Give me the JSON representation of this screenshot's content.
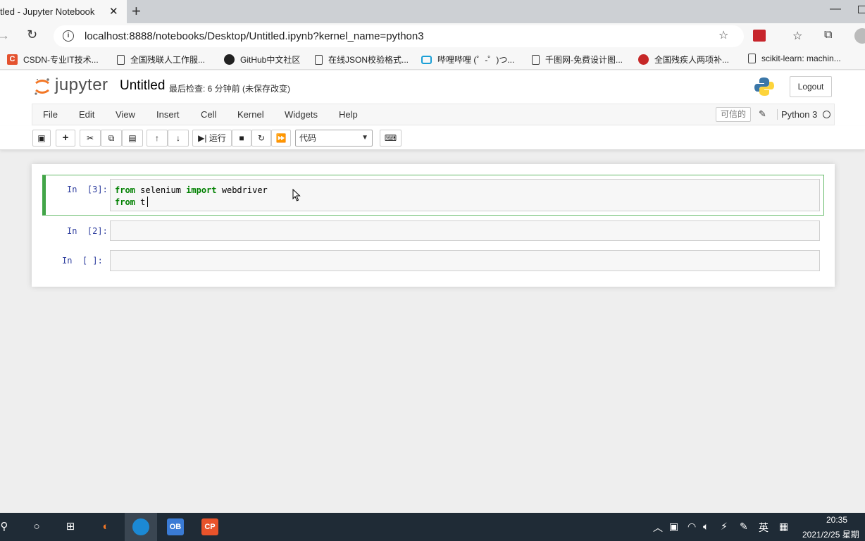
{
  "browser": {
    "tab_title": "tled - Jupyter Notebook",
    "tab_close": "✕",
    "new_tab": "+",
    "url": "localhost:8888/notebooks/Desktop/Untitled.ipynb?kernel_name=python3",
    "bookmarks": [
      {
        "label": "CSDN-专业IT技术...",
        "icon": "csdn-icon"
      },
      {
        "label": "全国残联人工作服...",
        "icon": "page-icon"
      },
      {
        "label": "GitHub中文社区",
        "icon": "github-icon"
      },
      {
        "label": "在线JSON校验格式...",
        "icon": "page-icon"
      },
      {
        "label": "哔哩哔哩 (゜-゜)つ...",
        "icon": "bilibili-icon"
      },
      {
        "label": "千图网-免费设计图...",
        "icon": "page-icon"
      },
      {
        "label": "全国残疾人两项补...",
        "icon": "red-seal-icon"
      },
      {
        "label": "scikit-learn: machin...",
        "icon": "page-icon"
      }
    ]
  },
  "jupyter": {
    "logo_text": "jupyter",
    "notebook_name": "Untitled",
    "checkpoint": "最后检查: 6 分钟前  (未保存改变)",
    "logout": "Logout",
    "menu": [
      "File",
      "Edit",
      "View",
      "Insert",
      "Cell",
      "Kernel",
      "Widgets",
      "Help"
    ],
    "trusted": "可信的",
    "kernel": "Python 3",
    "toolbar": {
      "run_label": "运行",
      "cell_type": "代码"
    },
    "cells": [
      {
        "prompt": "In  [3]:",
        "lines": [
          {
            "kw": "from",
            "text": " selenium ",
            "kw2": "import",
            "text2": " webdriver"
          },
          {
            "kw": "from",
            "text": " t",
            "kw2": "",
            "text2": ""
          }
        ]
      },
      {
        "prompt": "In  [2]:"
      },
      {
        "prompt": "In  [ ]:"
      }
    ]
  },
  "taskbar": {
    "time": "20:35",
    "date": "2021/2/25 星期",
    "ime": "英",
    "apps": [
      "OB",
      "CP"
    ]
  },
  "colors": {
    "accent_green": "#42a548",
    "prompt_blue": "#303f9f",
    "keyword_green": "#008000"
  }
}
